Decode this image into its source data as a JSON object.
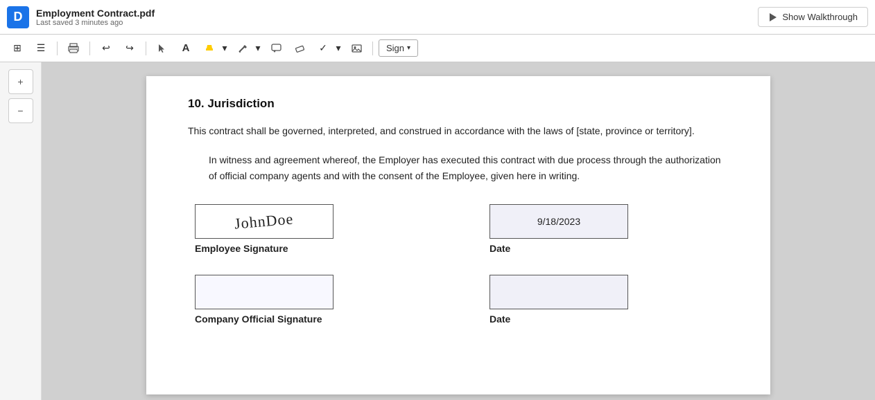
{
  "topbar": {
    "logo": "D",
    "doc_title": "Employment Contract.pdf",
    "doc_saved": "Last saved 3 minutes ago",
    "walkthrough_btn": "Show Walkthrough"
  },
  "toolbar": {
    "items": [
      {
        "name": "apps-icon",
        "symbol": "⊞"
      },
      {
        "name": "list-icon",
        "symbol": "☰"
      },
      {
        "name": "print-icon",
        "symbol": "🖨"
      },
      {
        "name": "undo-icon",
        "symbol": "↩"
      },
      {
        "name": "redo-icon",
        "symbol": "↪"
      },
      {
        "name": "cursor-icon",
        "symbol": "↖"
      },
      {
        "name": "text-icon",
        "symbol": "A"
      },
      {
        "name": "highlight-icon",
        "symbol": "✏"
      },
      {
        "name": "draw-icon",
        "symbol": "✏"
      },
      {
        "name": "comment-icon",
        "symbol": "💬"
      },
      {
        "name": "eraser-icon",
        "symbol": "⌫"
      },
      {
        "name": "checkmark-icon",
        "symbol": "✓"
      },
      {
        "name": "image-icon",
        "symbol": "🖼"
      },
      {
        "name": "sign-label",
        "symbol": "Sign"
      }
    ]
  },
  "sidebar": {
    "zoom_in_label": "+",
    "zoom_out_label": "−"
  },
  "document": {
    "section_number": "10. Jurisdiction",
    "paragraph1": "This contract shall be governed, interpreted, and construed in accordance with the laws of [state, province or territory].",
    "paragraph2": "In witness and agreement whereof, the Employer has executed this contract with due process through the authorization of official company agents and with the consent of the Employee, given here in writing.",
    "employee_sig_label": "Employee Signature",
    "employee_sig_value": "JohnDoe",
    "date_label1": "Date",
    "date_value": "9/18/2023",
    "company_sig_label": "Company Official Signature",
    "date_label2": "Date"
  }
}
